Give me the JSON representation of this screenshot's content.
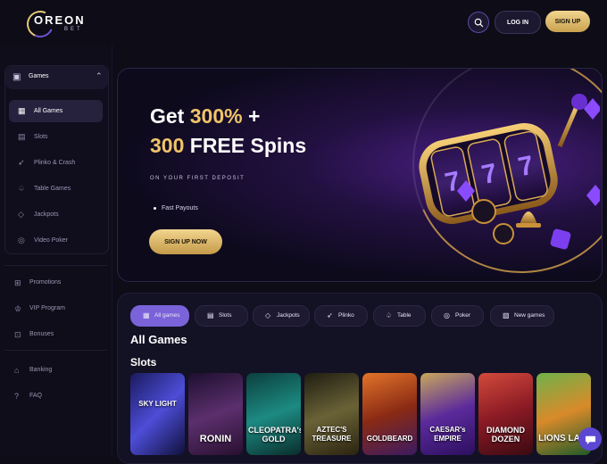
{
  "brand": {
    "name": "OREON",
    "sub": "BET"
  },
  "header": {
    "login_label": "LOG IN",
    "signup_label": "SIGN UP"
  },
  "sidebar": {
    "games_group": {
      "label": "Games",
      "icon": "cards-icon"
    },
    "game_items": [
      {
        "label": "All Games",
        "icon": "grid-icon",
        "active": true
      },
      {
        "label": "Slots",
        "icon": "slot-icon"
      },
      {
        "label": "Plinko & Crash",
        "icon": "rocket-icon"
      },
      {
        "label": "Table Games",
        "icon": "spade-icon"
      },
      {
        "label": "Jackpots",
        "icon": "diamond-icon"
      },
      {
        "label": "Video Poker",
        "icon": "chip-icon"
      }
    ],
    "nav_items": [
      {
        "label": "Promotions",
        "icon": "gift-icon"
      },
      {
        "label": "VIP Program",
        "icon": "crown-icon"
      },
      {
        "label": "Bonuses",
        "icon": "percent-icon"
      },
      {
        "label": "Banking",
        "icon": "bank-icon"
      },
      {
        "label": "FAQ",
        "icon": "help-icon"
      }
    ]
  },
  "banner": {
    "line1_prefix": "Get ",
    "line1_highlight": "300%",
    "line1_suffix": " +",
    "line2_highlight": "300",
    "line2_suffix": " FREE Spins",
    "subtext": "ON YOUR FIRST DEPOSIT",
    "feature": "Fast Payouts",
    "cta": "SIGN UP NOW"
  },
  "tabs": [
    {
      "label": "All games",
      "icon": "grid-icon",
      "active": true
    },
    {
      "label": "Slots",
      "icon": "slot-icon"
    },
    {
      "label": "Jackpots",
      "icon": "diamond-icon"
    },
    {
      "label": "Plinko",
      "icon": "rocket-icon"
    },
    {
      "label": "Table",
      "icon": "spade-icon"
    },
    {
      "label": "Poker",
      "icon": "chip-icon"
    },
    {
      "label": "New games",
      "icon": "new-icon"
    }
  ],
  "section_title": "All Games",
  "section_sub": "Slots",
  "games": [
    {
      "title": "SKY LIGHT",
      "bg": "#2a2a8e"
    },
    {
      "title": "RONIN",
      "bg": "#3b1c52"
    },
    {
      "title": "CLEOPATRA's GOLD",
      "bg": "#0f5a5c"
    },
    {
      "title": "AZTEC'S TREASURE",
      "bg": "#3d3b24"
    },
    {
      "title": "GOLDBEARD",
      "bg": "#b64c1d"
    },
    {
      "title": "CAESAR's EMPIRE",
      "bg": "#4d1e84"
    },
    {
      "title": "DIAMOND DOZEN",
      "bg": "#a42a2e"
    },
    {
      "title": "LIONS LAIR",
      "bg": "#2f7b3c"
    }
  ],
  "colors": {
    "accent": "#7a63d9",
    "gold": "#f0c46a",
    "bg": "#0d0c17"
  }
}
